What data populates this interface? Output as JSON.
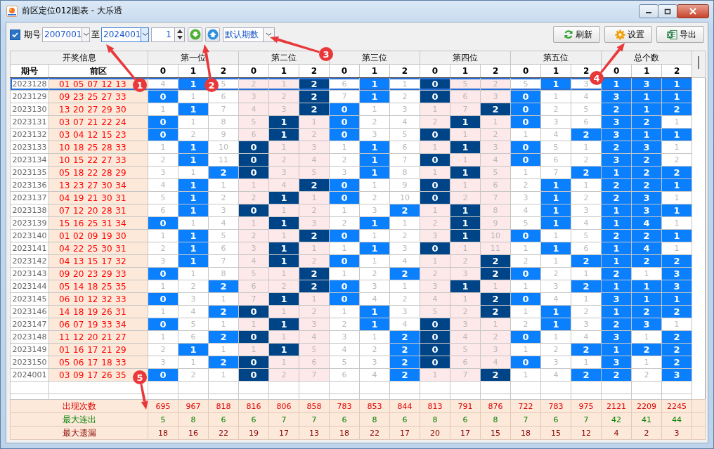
{
  "window": {
    "title": "前区定位012图表 - 大乐透"
  },
  "toolbar": {
    "period_toggle": {
      "label": "期号",
      "checked": true
    },
    "from": "2007001",
    "to_label": "至",
    "to": "2024001",
    "step": "1",
    "period_select": "默认期数",
    "buttons": [
      {
        "label": "刷新",
        "kind": "refresh"
      },
      {
        "label": "设置",
        "kind": "settings"
      },
      {
        "label": "导出",
        "kind": "export"
      }
    ]
  },
  "table": {
    "groups": [
      "开奖信息",
      "第一位",
      "第二位",
      "第三位",
      "第四位",
      "第五位",
      "总个数"
    ],
    "columns": [
      "期号",
      "前区",
      "0",
      "1",
      "2",
      "0",
      "1",
      "2",
      "0",
      "1",
      "2",
      "0",
      "1",
      "2",
      "0",
      "1",
      "2",
      "0",
      "1",
      "2"
    ],
    "rows": [
      {
        "period": "2023128",
        "numbers": "01 05 07 12 13",
        "selected": true,
        "values": [
          "4",
          "1",
          "5",
          "2",
          "1",
          "2",
          "6",
          "1",
          "1",
          "0",
          "5",
          "2",
          "5",
          "1",
          "3",
          "1",
          "3",
          "1"
        ],
        "hit": [
          false,
          true,
          false,
          false,
          false,
          true,
          false,
          true,
          false,
          true,
          false,
          false,
          false,
          true,
          false,
          true,
          true,
          true
        ]
      },
      {
        "period": "2023129",
        "numbers": "09 23 25 27 33",
        "selected": false,
        "values": [
          "0",
          "1",
          "6",
          "3",
          "2",
          "2",
          "7",
          "1",
          "2",
          "0",
          "6",
          "3",
          "0",
          "1",
          "4",
          "3",
          "1",
          "1"
        ],
        "hit": [
          true,
          false,
          false,
          false,
          false,
          true,
          false,
          true,
          false,
          true,
          false,
          false,
          true,
          false,
          false,
          true,
          true,
          true
        ]
      },
      {
        "period": "2023130",
        "numbers": "13 20 27 29 30",
        "selected": false,
        "values": [
          "1",
          "1",
          "7",
          "4",
          "3",
          "2",
          "0",
          "1",
          "3",
          "1",
          "7",
          "2",
          "0",
          "2",
          "5",
          "2",
          "1",
          "2"
        ],
        "hit": [
          false,
          true,
          false,
          false,
          false,
          true,
          true,
          false,
          false,
          false,
          false,
          true,
          true,
          false,
          false,
          true,
          true,
          true
        ]
      },
      {
        "period": "2023131",
        "numbers": "03 07 21 22 24",
        "selected": false,
        "values": [
          "0",
          "1",
          "8",
          "5",
          "1",
          "1",
          "0",
          "2",
          "4",
          "2",
          "1",
          "1",
          "0",
          "3",
          "6",
          "3",
          "2",
          "1"
        ],
        "hit": [
          true,
          false,
          false,
          false,
          true,
          false,
          true,
          false,
          false,
          false,
          true,
          false,
          true,
          false,
          false,
          true,
          true,
          false
        ]
      },
      {
        "period": "2023132",
        "numbers": "03 04 12 15 23",
        "selected": false,
        "values": [
          "0",
          "2",
          "9",
          "6",
          "1",
          "2",
          "0",
          "3",
          "5",
          "0",
          "1",
          "2",
          "1",
          "4",
          "2",
          "3",
          "1",
          "1"
        ],
        "hit": [
          true,
          false,
          false,
          false,
          true,
          false,
          true,
          false,
          false,
          true,
          false,
          false,
          false,
          false,
          true,
          true,
          true,
          true
        ]
      },
      {
        "period": "2023133",
        "numbers": "10 18 25 28 33",
        "selected": false,
        "values": [
          "1",
          "1",
          "10",
          "0",
          "1",
          "3",
          "1",
          "1",
          "6",
          "1",
          "1",
          "3",
          "0",
          "5",
          "1",
          "2",
          "3",
          "1"
        ],
        "hit": [
          false,
          true,
          false,
          true,
          false,
          false,
          false,
          true,
          false,
          false,
          true,
          false,
          true,
          false,
          false,
          true,
          true,
          false
        ]
      },
      {
        "period": "2023134",
        "numbers": "10 15 22 27 33",
        "selected": false,
        "values": [
          "2",
          "1",
          "11",
          "0",
          "2",
          "4",
          "2",
          "1",
          "7",
          "0",
          "1",
          "4",
          "0",
          "6",
          "2",
          "3",
          "2",
          "2"
        ],
        "hit": [
          false,
          true,
          false,
          true,
          false,
          false,
          false,
          true,
          false,
          true,
          false,
          false,
          true,
          false,
          false,
          true,
          true,
          false
        ]
      },
      {
        "period": "2023135",
        "numbers": "05 18 22 28 29",
        "selected": false,
        "values": [
          "3",
          "1",
          "2",
          "0",
          "3",
          "5",
          "3",
          "1",
          "8",
          "1",
          "1",
          "5",
          "1",
          "7",
          "2",
          "1",
          "2",
          "2"
        ],
        "hit": [
          false,
          false,
          true,
          true,
          false,
          false,
          false,
          true,
          false,
          false,
          true,
          false,
          false,
          false,
          true,
          true,
          true,
          true
        ]
      },
      {
        "period": "2023136",
        "numbers": "13 23 27 30 34",
        "selected": false,
        "values": [
          "4",
          "1",
          "1",
          "1",
          "4",
          "2",
          "0",
          "1",
          "9",
          "0",
          "1",
          "6",
          "2",
          "1",
          "1",
          "2",
          "2",
          "1"
        ],
        "hit": [
          false,
          true,
          false,
          false,
          false,
          true,
          true,
          false,
          false,
          true,
          false,
          false,
          false,
          true,
          false,
          true,
          true,
          true
        ]
      },
      {
        "period": "2023137",
        "numbers": "04 19 21 30 31",
        "selected": false,
        "values": [
          "5",
          "1",
          "2",
          "2",
          "1",
          "1",
          "0",
          "2",
          "10",
          "0",
          "2",
          "7",
          "3",
          "1",
          "2",
          "2",
          "3",
          "1"
        ],
        "hit": [
          false,
          true,
          false,
          false,
          true,
          false,
          true,
          false,
          false,
          true,
          false,
          false,
          false,
          true,
          false,
          true,
          true,
          false
        ]
      },
      {
        "period": "2023138",
        "numbers": "07 12 20 28 31",
        "selected": false,
        "values": [
          "6",
          "1",
          "3",
          "0",
          "1",
          "2",
          "1",
          "3",
          "2",
          "1",
          "1",
          "8",
          "4",
          "1",
          "3",
          "1",
          "3",
          "1"
        ],
        "hit": [
          false,
          true,
          false,
          true,
          false,
          false,
          false,
          false,
          true,
          false,
          true,
          false,
          false,
          true,
          false,
          true,
          true,
          true
        ]
      },
      {
        "period": "2023139",
        "numbers": "15 16 25 31 34",
        "selected": false,
        "values": [
          "0",
          "1",
          "4",
          "1",
          "1",
          "3",
          "2",
          "1",
          "1",
          "2",
          "1",
          "9",
          "5",
          "1",
          "4",
          "1",
          "4",
          "1"
        ],
        "hit": [
          true,
          false,
          false,
          false,
          true,
          false,
          false,
          true,
          false,
          false,
          true,
          false,
          false,
          true,
          false,
          true,
          true,
          false
        ]
      },
      {
        "period": "2023140",
        "numbers": "01 02 09 19 30",
        "selected": false,
        "values": [
          "1",
          "1",
          "5",
          "2",
          "1",
          "2",
          "0",
          "1",
          "2",
          "3",
          "1",
          "10",
          "0",
          "1",
          "5",
          "2",
          "2",
          "1"
        ],
        "hit": [
          false,
          true,
          false,
          false,
          false,
          true,
          true,
          false,
          false,
          false,
          true,
          false,
          true,
          false,
          false,
          true,
          true,
          true
        ]
      },
      {
        "period": "2023141",
        "numbers": "04 22 25 30 31",
        "selected": false,
        "values": [
          "2",
          "1",
          "6",
          "3",
          "1",
          "1",
          "1",
          "1",
          "3",
          "0",
          "1",
          "11",
          "1",
          "1",
          "6",
          "1",
          "4",
          "1"
        ],
        "hit": [
          false,
          true,
          false,
          false,
          true,
          false,
          false,
          true,
          false,
          true,
          false,
          false,
          false,
          true,
          false,
          true,
          true,
          false
        ]
      },
      {
        "period": "2023142",
        "numbers": "04 13 15 17 32",
        "selected": false,
        "values": [
          "3",
          "1",
          "7",
          "4",
          "1",
          "2",
          "0",
          "1",
          "4",
          "1",
          "2",
          "2",
          "2",
          "1",
          "2",
          "1",
          "2",
          "2"
        ],
        "hit": [
          false,
          true,
          false,
          false,
          true,
          false,
          true,
          false,
          false,
          false,
          false,
          true,
          false,
          false,
          true,
          true,
          true,
          true
        ]
      },
      {
        "period": "2023143",
        "numbers": "09 20 23 29 33",
        "selected": false,
        "values": [
          "0",
          "1",
          "8",
          "5",
          "1",
          "2",
          "1",
          "2",
          "2",
          "2",
          "3",
          "2",
          "0",
          "2",
          "1",
          "2",
          "1",
          "3"
        ],
        "hit": [
          true,
          false,
          false,
          false,
          false,
          true,
          false,
          false,
          true,
          false,
          false,
          true,
          true,
          false,
          false,
          true,
          false,
          true
        ]
      },
      {
        "period": "2023144",
        "numbers": "05 14 18 25 35",
        "selected": false,
        "values": [
          "1",
          "2",
          "2",
          "6",
          "2",
          "2",
          "0",
          "3",
          "1",
          "3",
          "1",
          "1",
          "1",
          "3",
          "2",
          "1",
          "1",
          "3"
        ],
        "hit": [
          false,
          false,
          true,
          false,
          false,
          true,
          true,
          false,
          false,
          false,
          true,
          false,
          false,
          false,
          true,
          true,
          true,
          true
        ]
      },
      {
        "period": "2023145",
        "numbers": "06 10 12 32 33",
        "selected": false,
        "values": [
          "0",
          "3",
          "1",
          "7",
          "1",
          "1",
          "0",
          "4",
          "2",
          "4",
          "1",
          "2",
          "0",
          "4",
          "1",
          "3",
          "1",
          "1"
        ],
        "hit": [
          true,
          false,
          false,
          false,
          true,
          false,
          true,
          false,
          false,
          false,
          false,
          true,
          true,
          false,
          false,
          true,
          true,
          true
        ]
      },
      {
        "period": "2023146",
        "numbers": "14 18 19 26 31",
        "selected": false,
        "values": [
          "1",
          "4",
          "2",
          "0",
          "1",
          "2",
          "1",
          "1",
          "3",
          "5",
          "2",
          "2",
          "1",
          "1",
          "2",
          "1",
          "2",
          "2"
        ],
        "hit": [
          false,
          false,
          true,
          true,
          false,
          false,
          false,
          true,
          false,
          false,
          false,
          true,
          false,
          true,
          false,
          true,
          true,
          true
        ]
      },
      {
        "period": "2023147",
        "numbers": "06 07 19 33 34",
        "selected": false,
        "values": [
          "0",
          "5",
          "1",
          "1",
          "1",
          "3",
          "2",
          "1",
          "4",
          "0",
          "3",
          "1",
          "2",
          "1",
          "3",
          "2",
          "3",
          "1"
        ],
        "hit": [
          true,
          false,
          false,
          false,
          true,
          false,
          false,
          true,
          false,
          true,
          false,
          false,
          false,
          true,
          false,
          true,
          true,
          false
        ]
      },
      {
        "period": "2023148",
        "numbers": "11 12 20 21 27",
        "selected": false,
        "values": [
          "1",
          "6",
          "2",
          "0",
          "1",
          "4",
          "3",
          "1",
          "2",
          "0",
          "4",
          "2",
          "0",
          "1",
          "4",
          "3",
          "1",
          "2"
        ],
        "hit": [
          false,
          false,
          true,
          true,
          false,
          false,
          false,
          false,
          true,
          true,
          false,
          false,
          true,
          false,
          false,
          true,
          false,
          true
        ]
      },
      {
        "period": "2023149",
        "numbers": "01 16 17 21 29",
        "selected": false,
        "values": [
          "2",
          "1",
          "1",
          "1",
          "1",
          "5",
          "4",
          "2",
          "2",
          "0",
          "5",
          "3",
          "1",
          "2",
          "2",
          "1",
          "2",
          "2"
        ],
        "hit": [
          false,
          true,
          false,
          false,
          true,
          false,
          false,
          false,
          true,
          true,
          false,
          false,
          false,
          false,
          true,
          true,
          true,
          true
        ]
      },
      {
        "period": "2023150",
        "numbers": "05 06 17 18 33",
        "selected": false,
        "values": [
          "3",
          "1",
          "2",
          "0",
          "1",
          "6",
          "5",
          "3",
          "2",
          "0",
          "6",
          "4",
          "0",
          "3",
          "1",
          "3",
          "1",
          "2"
        ],
        "hit": [
          false,
          false,
          true,
          true,
          false,
          false,
          false,
          false,
          true,
          true,
          false,
          false,
          true,
          false,
          false,
          true,
          false,
          true
        ]
      },
      {
        "period": "2024001",
        "numbers": "03 09 17 26 35",
        "selected": false,
        "values": [
          "0",
          "2",
          "1",
          "0",
          "2",
          "7",
          "6",
          "4",
          "2",
          "1",
          "7",
          "2",
          "1",
          "4",
          "2",
          "2",
          "2",
          "3"
        ],
        "hit": [
          true,
          false,
          false,
          true,
          false,
          false,
          false,
          false,
          true,
          false,
          false,
          true,
          false,
          false,
          true,
          true,
          false,
          true
        ]
      }
    ]
  },
  "stats": [
    {
      "label": "出现次数",
      "kind": "count",
      "values": [
        "695",
        "967",
        "818",
        "816",
        "806",
        "858",
        "783",
        "853",
        "844",
        "813",
        "791",
        "876",
        "722",
        "783",
        "975",
        "2121",
        "2209",
        "2245"
      ]
    },
    {
      "label": "最大连出",
      "kind": "streak",
      "values": [
        "5",
        "8",
        "6",
        "6",
        "7",
        "7",
        "6",
        "8",
        "6",
        "8",
        "6",
        "8",
        "7",
        "6",
        "7",
        "42",
        "41",
        "44"
      ]
    },
    {
      "label": "最大遗漏",
      "kind": "omission",
      "values": [
        "18",
        "16",
        "22",
        "19",
        "17",
        "13",
        "18",
        "22",
        "17",
        "20",
        "17",
        "15",
        "18",
        "15",
        "12",
        "4",
        "2",
        "3"
      ]
    }
  ],
  "annotations": [
    {
      "label": "1"
    },
    {
      "label": "2"
    },
    {
      "label": "3"
    },
    {
      "label": "4"
    },
    {
      "label": "5"
    }
  ]
}
